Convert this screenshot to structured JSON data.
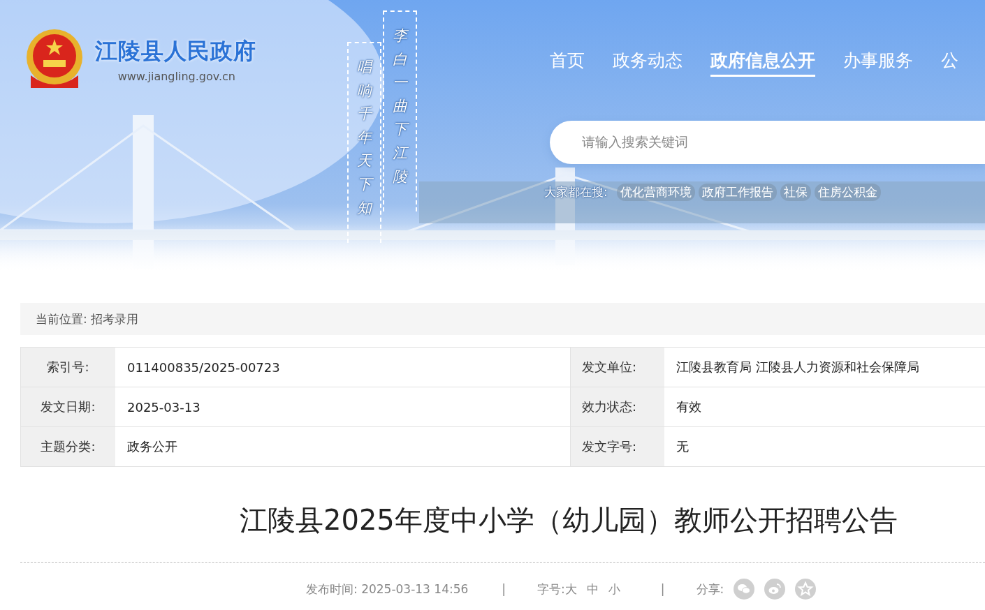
{
  "site": {
    "title": "江陵县人民政府",
    "url": "www.jiangling.gov.cn"
  },
  "poem": [
    "李白一曲下江陵",
    "唱响千年天下知"
  ],
  "nav": [
    {
      "label": "首页",
      "selected": false
    },
    {
      "label": "政务动态",
      "selected": false
    },
    {
      "label": "政府信息公开",
      "selected": true
    },
    {
      "label": "办事服务",
      "selected": false
    },
    {
      "label": "公",
      "selected": false
    }
  ],
  "search": {
    "placeholder": "请输入搜索关键词"
  },
  "hot_search": {
    "label": "大家都在搜:",
    "tags": [
      "优化营商环境",
      "政府工作报告",
      "社保",
      "住房公积金"
    ]
  },
  "breadcrumb": "当前位置: 招考录用",
  "info_table": [
    [
      {
        "label": "索引号:",
        "value": "011400835/2025-00723"
      },
      {
        "label": "发文单位:",
        "value": "江陵县教育局 江陵县人力资源和社会保障局"
      }
    ],
    [
      {
        "label": "发文日期:",
        "value": "2025-03-13"
      },
      {
        "label": "效力状态:",
        "value": "有效"
      }
    ],
    [
      {
        "label": "主题分类:",
        "value": "政务公开"
      },
      {
        "label": "发文字号:",
        "value": "无"
      }
    ]
  ],
  "article": {
    "title": "江陵县2025年度中小学（幼儿园）教师公开招聘公告",
    "published": "发布时间: 2025-03-13 14:56",
    "separator": "|",
    "font_size_label": "字号:",
    "font_sizes": [
      "大",
      "中",
      "小"
    ],
    "share_label": "分享:",
    "share": [
      {
        "kind": "wechat"
      },
      {
        "kind": "weibo"
      },
      {
        "kind": "favorite"
      }
    ]
  }
}
